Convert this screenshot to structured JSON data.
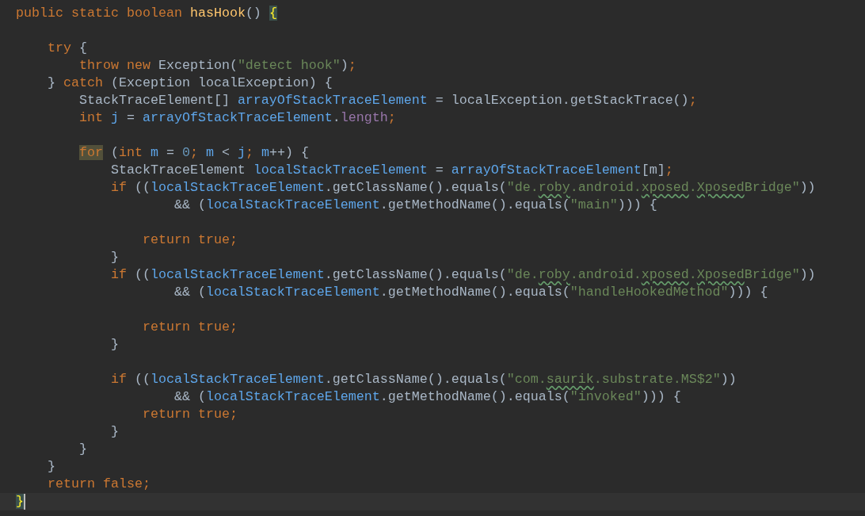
{
  "editor": {
    "lines": [
      {
        "current": false,
        "tokens": [
          {
            "kind": "kw",
            "text": "public static boolean "
          },
          {
            "kind": "decl",
            "text": "hasHook"
          },
          {
            "kind": "plain",
            "text": "() "
          },
          {
            "kind": "brace",
            "text": "{",
            "highlighted": true
          }
        ]
      },
      {
        "current": false
      },
      {
        "current": false,
        "tokens": [
          {
            "kind": "kw",
            "text": "    try"
          },
          {
            "kind": "plain",
            "text": " {"
          }
        ]
      },
      {
        "current": false,
        "tokens": [
          {
            "kind": "kw",
            "text": "        throw new"
          },
          {
            "kind": "plain",
            "text": " Exception("
          },
          {
            "kind": "str",
            "text": "\"detect hook\""
          },
          {
            "kind": "plain",
            "text": ")"
          },
          {
            "kind": "kw",
            "text": ";"
          }
        ]
      },
      {
        "current": false,
        "tokens": [
          {
            "kind": "plain",
            "text": "    } "
          },
          {
            "kind": "kw",
            "text": "catch"
          },
          {
            "kind": "plain",
            "text": " (Exception localException) {"
          }
        ]
      },
      {
        "current": false,
        "tokens": [
          {
            "kind": "plain",
            "text": "        StackTraceElement[] "
          },
          {
            "kind": "var",
            "text": "arrayOfStackTraceElement"
          },
          {
            "kind": "plain",
            "text": " = localException.getStackTrace()"
          },
          {
            "kind": "kw",
            "text": ";"
          }
        ]
      },
      {
        "current": false,
        "tokens": [
          {
            "kind": "kw",
            "text": "        int "
          },
          {
            "kind": "var",
            "text": "j"
          },
          {
            "kind": "plain",
            "text": " = "
          },
          {
            "kind": "var",
            "text": "arrayOfStackTraceElement"
          },
          {
            "kind": "plain",
            "text": "."
          },
          {
            "kind": "field",
            "text": "length"
          },
          {
            "kind": "kw",
            "text": ";"
          }
        ]
      },
      {
        "current": false
      },
      {
        "current": false,
        "tokens": [
          {
            "kind": "kw",
            "text": "        for",
            "highlighted": true
          },
          {
            "kind": "plain",
            "text": " ("
          },
          {
            "kind": "kw",
            "text": "int "
          },
          {
            "kind": "var",
            "text": "m"
          },
          {
            "kind": "plain",
            "text": " = "
          },
          {
            "kind": "num",
            "text": "0"
          },
          {
            "kind": "kw",
            "text": "; "
          },
          {
            "kind": "var",
            "text": "m"
          },
          {
            "kind": "plain",
            "text": " < "
          },
          {
            "kind": "var",
            "text": "j"
          },
          {
            "kind": "kw",
            "text": "; "
          },
          {
            "kind": "var",
            "text": "m"
          },
          {
            "kind": "plain",
            "text": "++) {"
          }
        ]
      },
      {
        "current": false,
        "tokens": [
          {
            "kind": "plain",
            "text": "            StackTraceElement "
          },
          {
            "kind": "var",
            "text": "localStackTraceElement"
          },
          {
            "kind": "plain",
            "text": " = "
          },
          {
            "kind": "var",
            "text": "arrayOfStackTraceElement"
          },
          {
            "kind": "plain",
            "text": "[m]"
          },
          {
            "kind": "kw",
            "text": ";"
          }
        ]
      },
      {
        "current": false,
        "tokens": [
          {
            "kind": "kw",
            "text": "            if"
          },
          {
            "kind": "plain",
            "text": " (("
          },
          {
            "kind": "var",
            "text": "localStackTraceElement"
          },
          {
            "kind": "plain",
            "text": ".getClassName().equals("
          },
          {
            "kind": "str",
            "text": "\"de."
          },
          {
            "kind": "str",
            "text": "roby",
            "typo": true
          },
          {
            "kind": "str",
            "text": ".android."
          },
          {
            "kind": "str",
            "text": "xposed",
            "typo": true
          },
          {
            "kind": "str",
            "text": "."
          },
          {
            "kind": "str",
            "text": "Xposed",
            "typo": true
          },
          {
            "kind": "str",
            "text": "Bridge\""
          },
          {
            "kind": "plain",
            "text": "))"
          }
        ]
      },
      {
        "current": false,
        "tokens": [
          {
            "kind": "plain",
            "text": "                    && ("
          },
          {
            "kind": "var",
            "text": "localStackTraceElement"
          },
          {
            "kind": "plain",
            "text": ".getMethodName().equals("
          },
          {
            "kind": "str",
            "text": "\"main\""
          },
          {
            "kind": "plain",
            "text": "))) {"
          }
        ]
      },
      {
        "current": false
      },
      {
        "current": false,
        "tokens": [
          {
            "kind": "kw",
            "text": "                return true;"
          }
        ]
      },
      {
        "current": false,
        "tokens": [
          {
            "kind": "plain",
            "text": "            }"
          }
        ]
      },
      {
        "current": false,
        "tokens": [
          {
            "kind": "kw",
            "text": "            if"
          },
          {
            "kind": "plain",
            "text": " (("
          },
          {
            "kind": "var",
            "text": "localStackTraceElement"
          },
          {
            "kind": "plain",
            "text": ".getClassName().equals("
          },
          {
            "kind": "str",
            "text": "\"de."
          },
          {
            "kind": "str",
            "text": "roby",
            "typo": true
          },
          {
            "kind": "str",
            "text": ".android."
          },
          {
            "kind": "str",
            "text": "xposed",
            "typo": true
          },
          {
            "kind": "str",
            "text": "."
          },
          {
            "kind": "str",
            "text": "Xposed",
            "typo": true
          },
          {
            "kind": "str",
            "text": "Bridge\""
          },
          {
            "kind": "plain",
            "text": "))"
          }
        ]
      },
      {
        "current": false,
        "tokens": [
          {
            "kind": "plain",
            "text": "                    && ("
          },
          {
            "kind": "var",
            "text": "localStackTraceElement"
          },
          {
            "kind": "plain",
            "text": ".getMethodName().equals("
          },
          {
            "kind": "str",
            "text": "\"handleHookedMethod\""
          },
          {
            "kind": "plain",
            "text": "))) {"
          }
        ]
      },
      {
        "current": false
      },
      {
        "current": false,
        "tokens": [
          {
            "kind": "kw",
            "text": "                return true;"
          }
        ]
      },
      {
        "current": false,
        "tokens": [
          {
            "kind": "plain",
            "text": "            }"
          }
        ]
      },
      {
        "current": false
      },
      {
        "current": false,
        "tokens": [
          {
            "kind": "kw",
            "text": "            if"
          },
          {
            "kind": "plain",
            "text": " (("
          },
          {
            "kind": "var",
            "text": "localStackTraceElement"
          },
          {
            "kind": "plain",
            "text": ".getClassName().equals("
          },
          {
            "kind": "str",
            "text": "\"com."
          },
          {
            "kind": "str",
            "text": "saurik",
            "typo": true
          },
          {
            "kind": "str",
            "text": ".substrate.MS$2\""
          },
          {
            "kind": "plain",
            "text": "))"
          }
        ]
      },
      {
        "current": false,
        "tokens": [
          {
            "kind": "plain",
            "text": "                    && ("
          },
          {
            "kind": "var",
            "text": "localStackTraceElement"
          },
          {
            "kind": "plain",
            "text": ".getMethodName().equals("
          },
          {
            "kind": "str",
            "text": "\"invoked\""
          },
          {
            "kind": "plain",
            "text": "))) {"
          }
        ]
      },
      {
        "current": false,
        "tokens": [
          {
            "kind": "kw",
            "text": "                return true;"
          }
        ]
      },
      {
        "current": false,
        "tokens": [
          {
            "kind": "plain",
            "text": "            }"
          }
        ]
      },
      {
        "current": false,
        "tokens": [
          {
            "kind": "plain",
            "text": "        }"
          }
        ]
      },
      {
        "current": false,
        "tokens": [
          {
            "kind": "plain",
            "text": "    }"
          }
        ]
      },
      {
        "current": false,
        "tokens": [
          {
            "kind": "kw",
            "text": "    return false;"
          }
        ]
      },
      {
        "current": true,
        "tokens": [
          {
            "kind": "brace",
            "text": "}",
            "highlighted": true
          }
        ]
      }
    ]
  }
}
